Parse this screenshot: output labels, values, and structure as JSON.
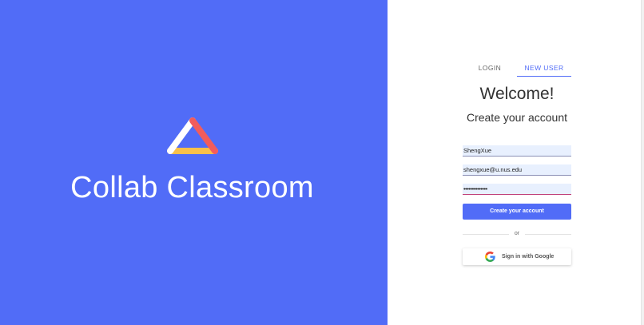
{
  "brand": {
    "title": "Collab Classroom",
    "logo_icon": "triangle-logo-icon",
    "background_color": "#516cf7"
  },
  "tabs": [
    {
      "label": "LOGIN",
      "active": false
    },
    {
      "label": "NEW USER",
      "active": true
    }
  ],
  "form": {
    "heading": "Welcome!",
    "subheading": "Create your account",
    "username_value": "ShengXue",
    "email_value": "shengxue@u.nus.edu",
    "password_mask": "••••••••••••••",
    "submit_label": "Create your account",
    "or_label": "or",
    "google_label": "Sign in with Google",
    "google_icon": "google-g-icon"
  },
  "colors": {
    "accent": "#516cf7",
    "logo_red": "#f25c5c",
    "logo_yellow": "#f9c04a",
    "input_fill": "#e8f0fe"
  }
}
